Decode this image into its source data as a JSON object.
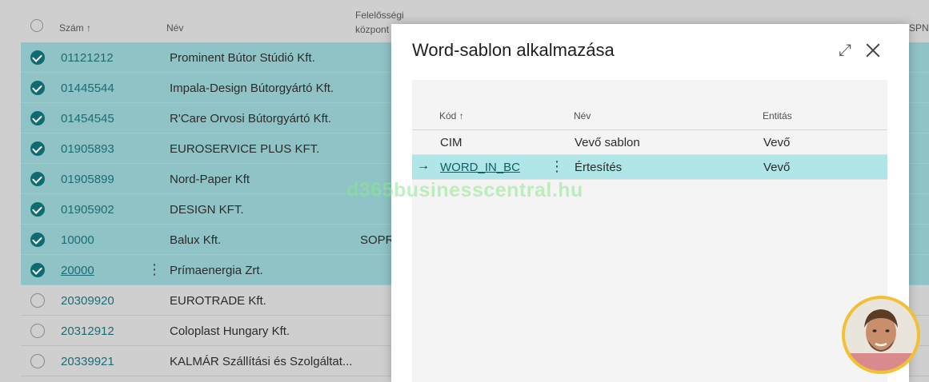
{
  "list": {
    "columns": {
      "number": "Szám",
      "name": "Név",
      "responsibility": "Felelősségi központ",
      "edge": "SPN"
    },
    "rows": [
      {
        "number": "01121212",
        "name": "Prominent Bútor Stúdió Kft.",
        "extra": "",
        "selected": true
      },
      {
        "number": "01445544",
        "name": "Impala-Design Bútorgyártó Kft.",
        "extra": "",
        "selected": true
      },
      {
        "number": "01454545",
        "name": "R'Care Orvosi Bútorgyártó Kft.",
        "extra": "",
        "selected": true
      },
      {
        "number": "01905893",
        "name": "EUROSERVICE PLUS KFT.",
        "extra": "",
        "selected": true
      },
      {
        "number": "01905899",
        "name": "Nord-Paper Kft",
        "extra": "",
        "selected": true
      },
      {
        "number": "01905902",
        "name": "DESIGN KFT.",
        "extra": "",
        "selected": true
      },
      {
        "number": "10000",
        "name": "Balux Kft.",
        "extra": "SOPR",
        "selected": true
      },
      {
        "number": "20000",
        "name": "Prímaenergia Zrt.",
        "extra": "",
        "selected": true
      },
      {
        "number": "20309920",
        "name": "EUROTRADE Kft.",
        "extra": "",
        "selected": false
      },
      {
        "number": "20312912",
        "name": "Coloplast Hungary Kft.",
        "extra": "",
        "selected": false
      },
      {
        "number": "20339921",
        "name": "KALMÁR Szállítási és Szolgáltat...",
        "extra": "",
        "selected": false
      }
    ]
  },
  "dialog": {
    "title": "Word-sablon alkalmazása",
    "columns": {
      "code": "Kód",
      "name": "Név",
      "entity": "Entitás"
    },
    "rows": [
      {
        "code": "CIM",
        "name": "Vevő sablon",
        "entity": "Vevő"
      },
      {
        "code": "WORD_IN_BC",
        "name": "Értesítés",
        "entity": "Vevő"
      }
    ]
  },
  "watermark": "d365businesscentral.hu",
  "colors": {
    "selection": "#8fc3c6",
    "accent": "#0f6b72",
    "dialog_selection": "#b1e6e8"
  }
}
